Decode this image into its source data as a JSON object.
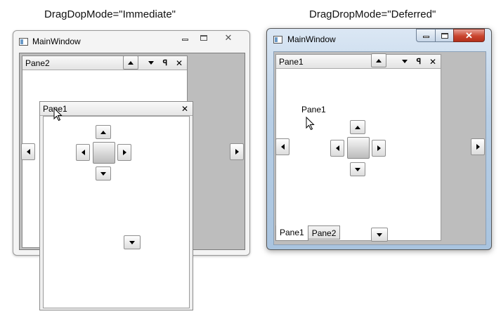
{
  "captions": {
    "left": "DragDopMode=\"Immediate\"",
    "right": "DragDropMode=\"Deferred\""
  },
  "windows": {
    "left": {
      "title": "MainWindow",
      "background_pane": {
        "title": "Pane2"
      },
      "floating_pane": {
        "title": "Pane1"
      }
    },
    "right": {
      "title": "MainWindow",
      "pane": {
        "title": "Pane1"
      },
      "drag_preview_label": "Pane1",
      "tabs": [
        {
          "label": "Pane1",
          "selected": true
        },
        {
          "label": "Pane2",
          "selected": false
        }
      ]
    }
  },
  "icons": {
    "minimize": "minimize-icon",
    "maximize": "maximize-icon",
    "close": "close-icon",
    "pin": "pin-icon",
    "menu": "dropdown-arrow-icon",
    "cursor": "mouse-pointer-icon"
  },
  "colors": {
    "client_background": "#bdbdbd",
    "close_button_red": "#c9452f",
    "window_frame_glass": "#bcd3ea"
  }
}
